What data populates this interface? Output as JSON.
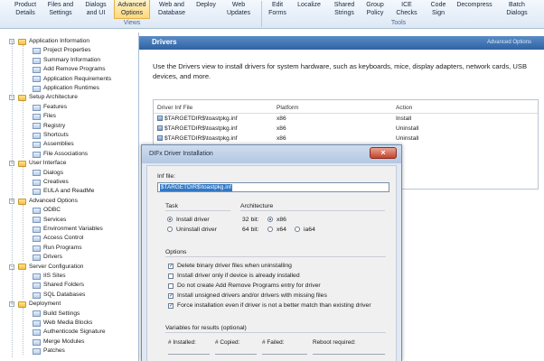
{
  "ribbon": {
    "buttons": [
      {
        "line1": "Product",
        "line2": "Details"
      },
      {
        "line1": "Files and",
        "line2": "Settings"
      },
      {
        "line1": "Dialogs",
        "line2": "and UI"
      },
      {
        "line1": "Advanced",
        "line2": "Options"
      },
      {
        "line1": "Web and",
        "line2": "Database"
      },
      {
        "line1": "Deploy",
        "line2": ""
      },
      {
        "line1": "Web",
        "line2": "Updates"
      },
      {
        "line1": "Edit",
        "line2": "Forms"
      },
      {
        "line1": "Localize",
        "line2": ""
      },
      {
        "line1": "Shared",
        "line2": "Strings"
      },
      {
        "line1": "Group",
        "line2": "Policy"
      },
      {
        "line1": "ICE",
        "line2": "Checks"
      },
      {
        "line1": "Code",
        "line2": "Sign"
      },
      {
        "line1": "Decompress",
        "line2": ""
      },
      {
        "line1": "Batch",
        "line2": "Dialogs"
      }
    ],
    "groups": {
      "views": "Views",
      "tools": "Tools"
    },
    "accent": "#ffd87a"
  },
  "sidebar": {
    "items": [
      {
        "label": "Application Information",
        "kind": "folder"
      },
      {
        "label": "Project Properties",
        "kind": "leaf"
      },
      {
        "label": "Summary Information",
        "kind": "leaf"
      },
      {
        "label": "Add Remove Programs",
        "kind": "leaf"
      },
      {
        "label": "Application Requirements",
        "kind": "leaf"
      },
      {
        "label": "Application Runtimes",
        "kind": "leaf"
      },
      {
        "label": "Setup Architecture",
        "kind": "folder"
      },
      {
        "label": "Features",
        "kind": "leaf"
      },
      {
        "label": "Files",
        "kind": "leaf"
      },
      {
        "label": "Registry",
        "kind": "leaf"
      },
      {
        "label": "Shortcuts",
        "kind": "leaf"
      },
      {
        "label": "Assemblies",
        "kind": "leaf"
      },
      {
        "label": "File Associations",
        "kind": "leaf"
      },
      {
        "label": "User Interface",
        "kind": "folder"
      },
      {
        "label": "Dialogs",
        "kind": "leaf"
      },
      {
        "label": "Creatives",
        "kind": "leaf"
      },
      {
        "label": "EULA and ReadMe",
        "kind": "leaf"
      },
      {
        "label": "Advanced Options",
        "kind": "folder"
      },
      {
        "label": "ODBC",
        "kind": "leaf"
      },
      {
        "label": "Services",
        "kind": "leaf"
      },
      {
        "label": "Environment Variables",
        "kind": "leaf"
      },
      {
        "label": "Access Control",
        "kind": "leaf"
      },
      {
        "label": "Run Programs",
        "kind": "leaf"
      },
      {
        "label": "Drivers",
        "kind": "leaf"
      },
      {
        "label": "Server Configuration",
        "kind": "folder"
      },
      {
        "label": "IIS Sites",
        "kind": "leaf"
      },
      {
        "label": "Shared Folders",
        "kind": "leaf"
      },
      {
        "label": "SQL Databases",
        "kind": "leaf"
      },
      {
        "label": "Deployment",
        "kind": "folder"
      },
      {
        "label": "Build Settings",
        "kind": "leaf"
      },
      {
        "label": "Web Media Blocks",
        "kind": "leaf"
      },
      {
        "label": "Authenticode Signature",
        "kind": "leaf"
      },
      {
        "label": "Merge Modules",
        "kind": "leaf"
      },
      {
        "label": "Patches",
        "kind": "leaf"
      }
    ]
  },
  "panel": {
    "title": "Drivers",
    "advanced_link": "Advanced Options",
    "intro": "Use the Drivers view to install drivers for system hardware, such as keyboards, mice, display adapters, network cards, USB devices, and more."
  },
  "drivers_table": {
    "headers": [
      "Driver Inf File",
      "Platform",
      "Action"
    ],
    "rows": [
      {
        "file": "$TARGETDIR$\\toastpkg.inf",
        "platform": "x86",
        "action": "Install"
      },
      {
        "file": "$TARGETDIR$\\toastpkg.inf",
        "platform": "x86",
        "action": "Uninstall"
      },
      {
        "file": "$TARGETDIR$\\toastpkg.inf",
        "platform": "x86",
        "action": "Uninstall"
      }
    ]
  },
  "dialog": {
    "title": "DIFx Driver Installation",
    "close_glyph": "×",
    "inf_label": "Inf file:",
    "inf_value": "$TARGETDIR$\\toastpkg.inf",
    "task_label": "Task",
    "task_options": [
      {
        "label": "Install driver",
        "selected": true
      },
      {
        "label": "Uninstall driver",
        "selected": false
      }
    ],
    "arch_label": "Architecture",
    "arch_32_label": "32 bit:",
    "arch_32_option": "x86",
    "arch_64_label": "64 bit:",
    "arch_64_options": [
      "x64",
      "ia64"
    ],
    "options_label": "Options",
    "options": [
      {
        "label": "Delete binary driver files when uninstalling",
        "checked": true
      },
      {
        "label": "Install driver only if device is already installed",
        "checked": false
      },
      {
        "label": "Do not create Add Remove Programs entry for driver",
        "checked": false
      },
      {
        "label": "Install unsigned drivers and/or drivers with missing files",
        "checked": true
      },
      {
        "label": "Force installation even if driver is not a better match than existing driver",
        "checked": true
      }
    ],
    "variables_label": "Variables for results (optional)",
    "variables": [
      "# Installed:",
      "# Copied:",
      "# Failed:",
      "Reboot required:"
    ]
  }
}
